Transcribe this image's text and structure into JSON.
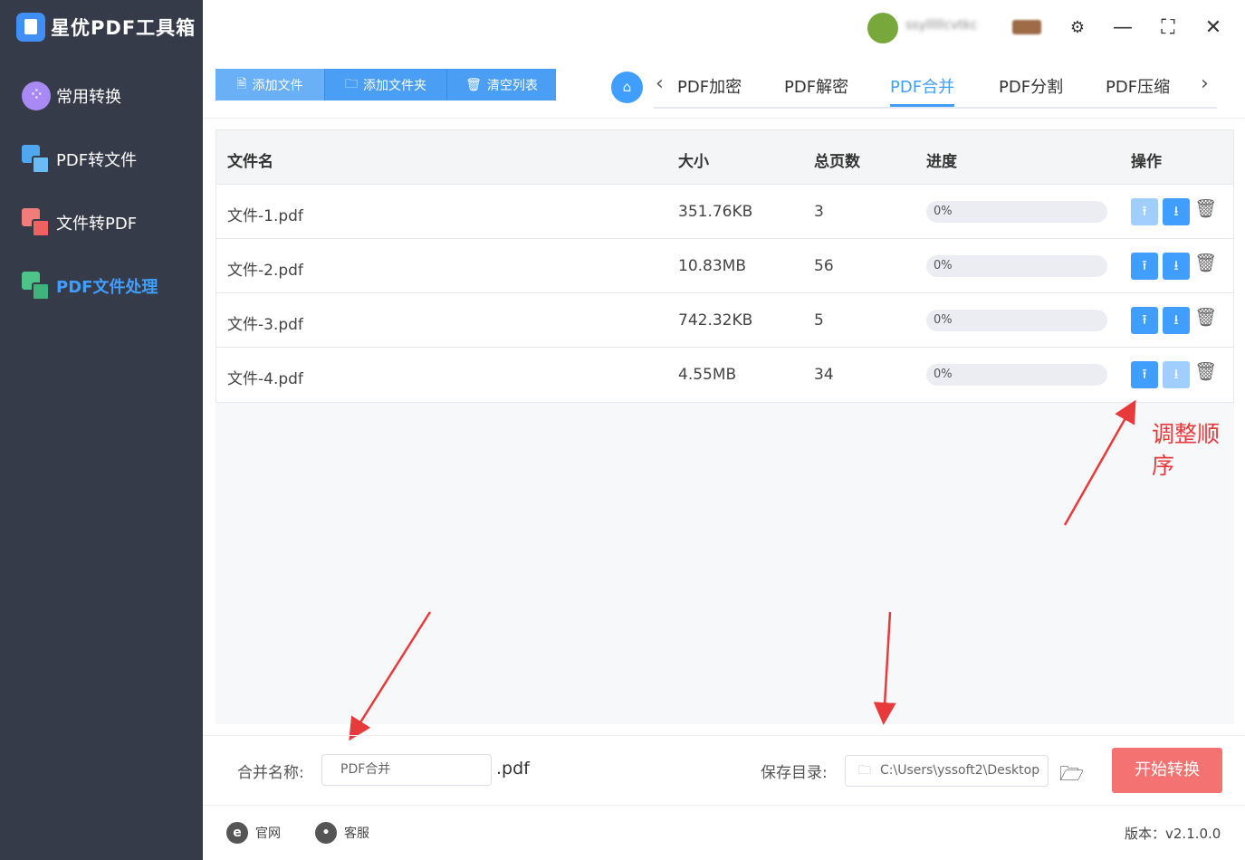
{
  "app": {
    "title": "星优PDF工具箱",
    "username": "ssylllllcvtkc"
  },
  "sidebar": {
    "items": [
      {
        "label": "常用转换",
        "icon": "grid-circle-icon"
      },
      {
        "label": "PDF转文件",
        "icon": "pdf-to-file-icon"
      },
      {
        "label": "文件转PDF",
        "icon": "file-to-pdf-icon"
      },
      {
        "label": "PDF文件处理",
        "icon": "pdf-process-icon",
        "active": true
      }
    ]
  },
  "window": {
    "settings_icon": "⚙",
    "minimize_icon": "—",
    "maximize_icon": "⛶",
    "close_icon": "✕"
  },
  "toolbar": {
    "add_file": "添加文件",
    "add_folder": "添加文件夹",
    "clear_list": "清空列表"
  },
  "tabs": {
    "items": [
      "PDF加密",
      "PDF解密",
      "PDF合并",
      "PDF分割",
      "PDF压缩"
    ],
    "active": "PDF合并"
  },
  "table": {
    "headers": {
      "name": "文件名",
      "size": "大小",
      "pages": "总页数",
      "progress": "进度",
      "actions": "操作"
    },
    "rows": [
      {
        "name": "文件-1.pdf",
        "size": "351.76KB",
        "pages": "3",
        "progress": "0%",
        "progress_value": 0,
        "up_enabled": false,
        "down_enabled": true
      },
      {
        "name": "文件-2.pdf",
        "size": "10.83MB",
        "pages": "56",
        "progress": "0%",
        "progress_value": 0,
        "up_enabled": true,
        "down_enabled": true
      },
      {
        "name": "文件-3.pdf",
        "size": "742.32KB",
        "pages": "5",
        "progress": "0%",
        "progress_value": 0,
        "up_enabled": true,
        "down_enabled": true
      },
      {
        "name": "文件-4.pdf",
        "size": "4.55MB",
        "pages": "34",
        "progress": "0%",
        "progress_value": 0,
        "up_enabled": true,
        "down_enabled": false
      }
    ]
  },
  "annotation": {
    "text": "调整顺序",
    "color": "#e8393b"
  },
  "bottom": {
    "merge_name_label": "合并名称:",
    "merge_name_value": "PDF合并",
    "merge_ext": ".pdf",
    "save_dir_label": "保存目录:",
    "save_dir_value": "C:\\Users\\yssoft2\\Desktop",
    "start_button": "开始转换"
  },
  "footer": {
    "website": "官网",
    "support": "客服",
    "version": "版本：v2.1.0.0"
  },
  "colors": {
    "sidebar_bg": "#363b49",
    "accent": "#409eff",
    "start_button": "#f47272"
  }
}
